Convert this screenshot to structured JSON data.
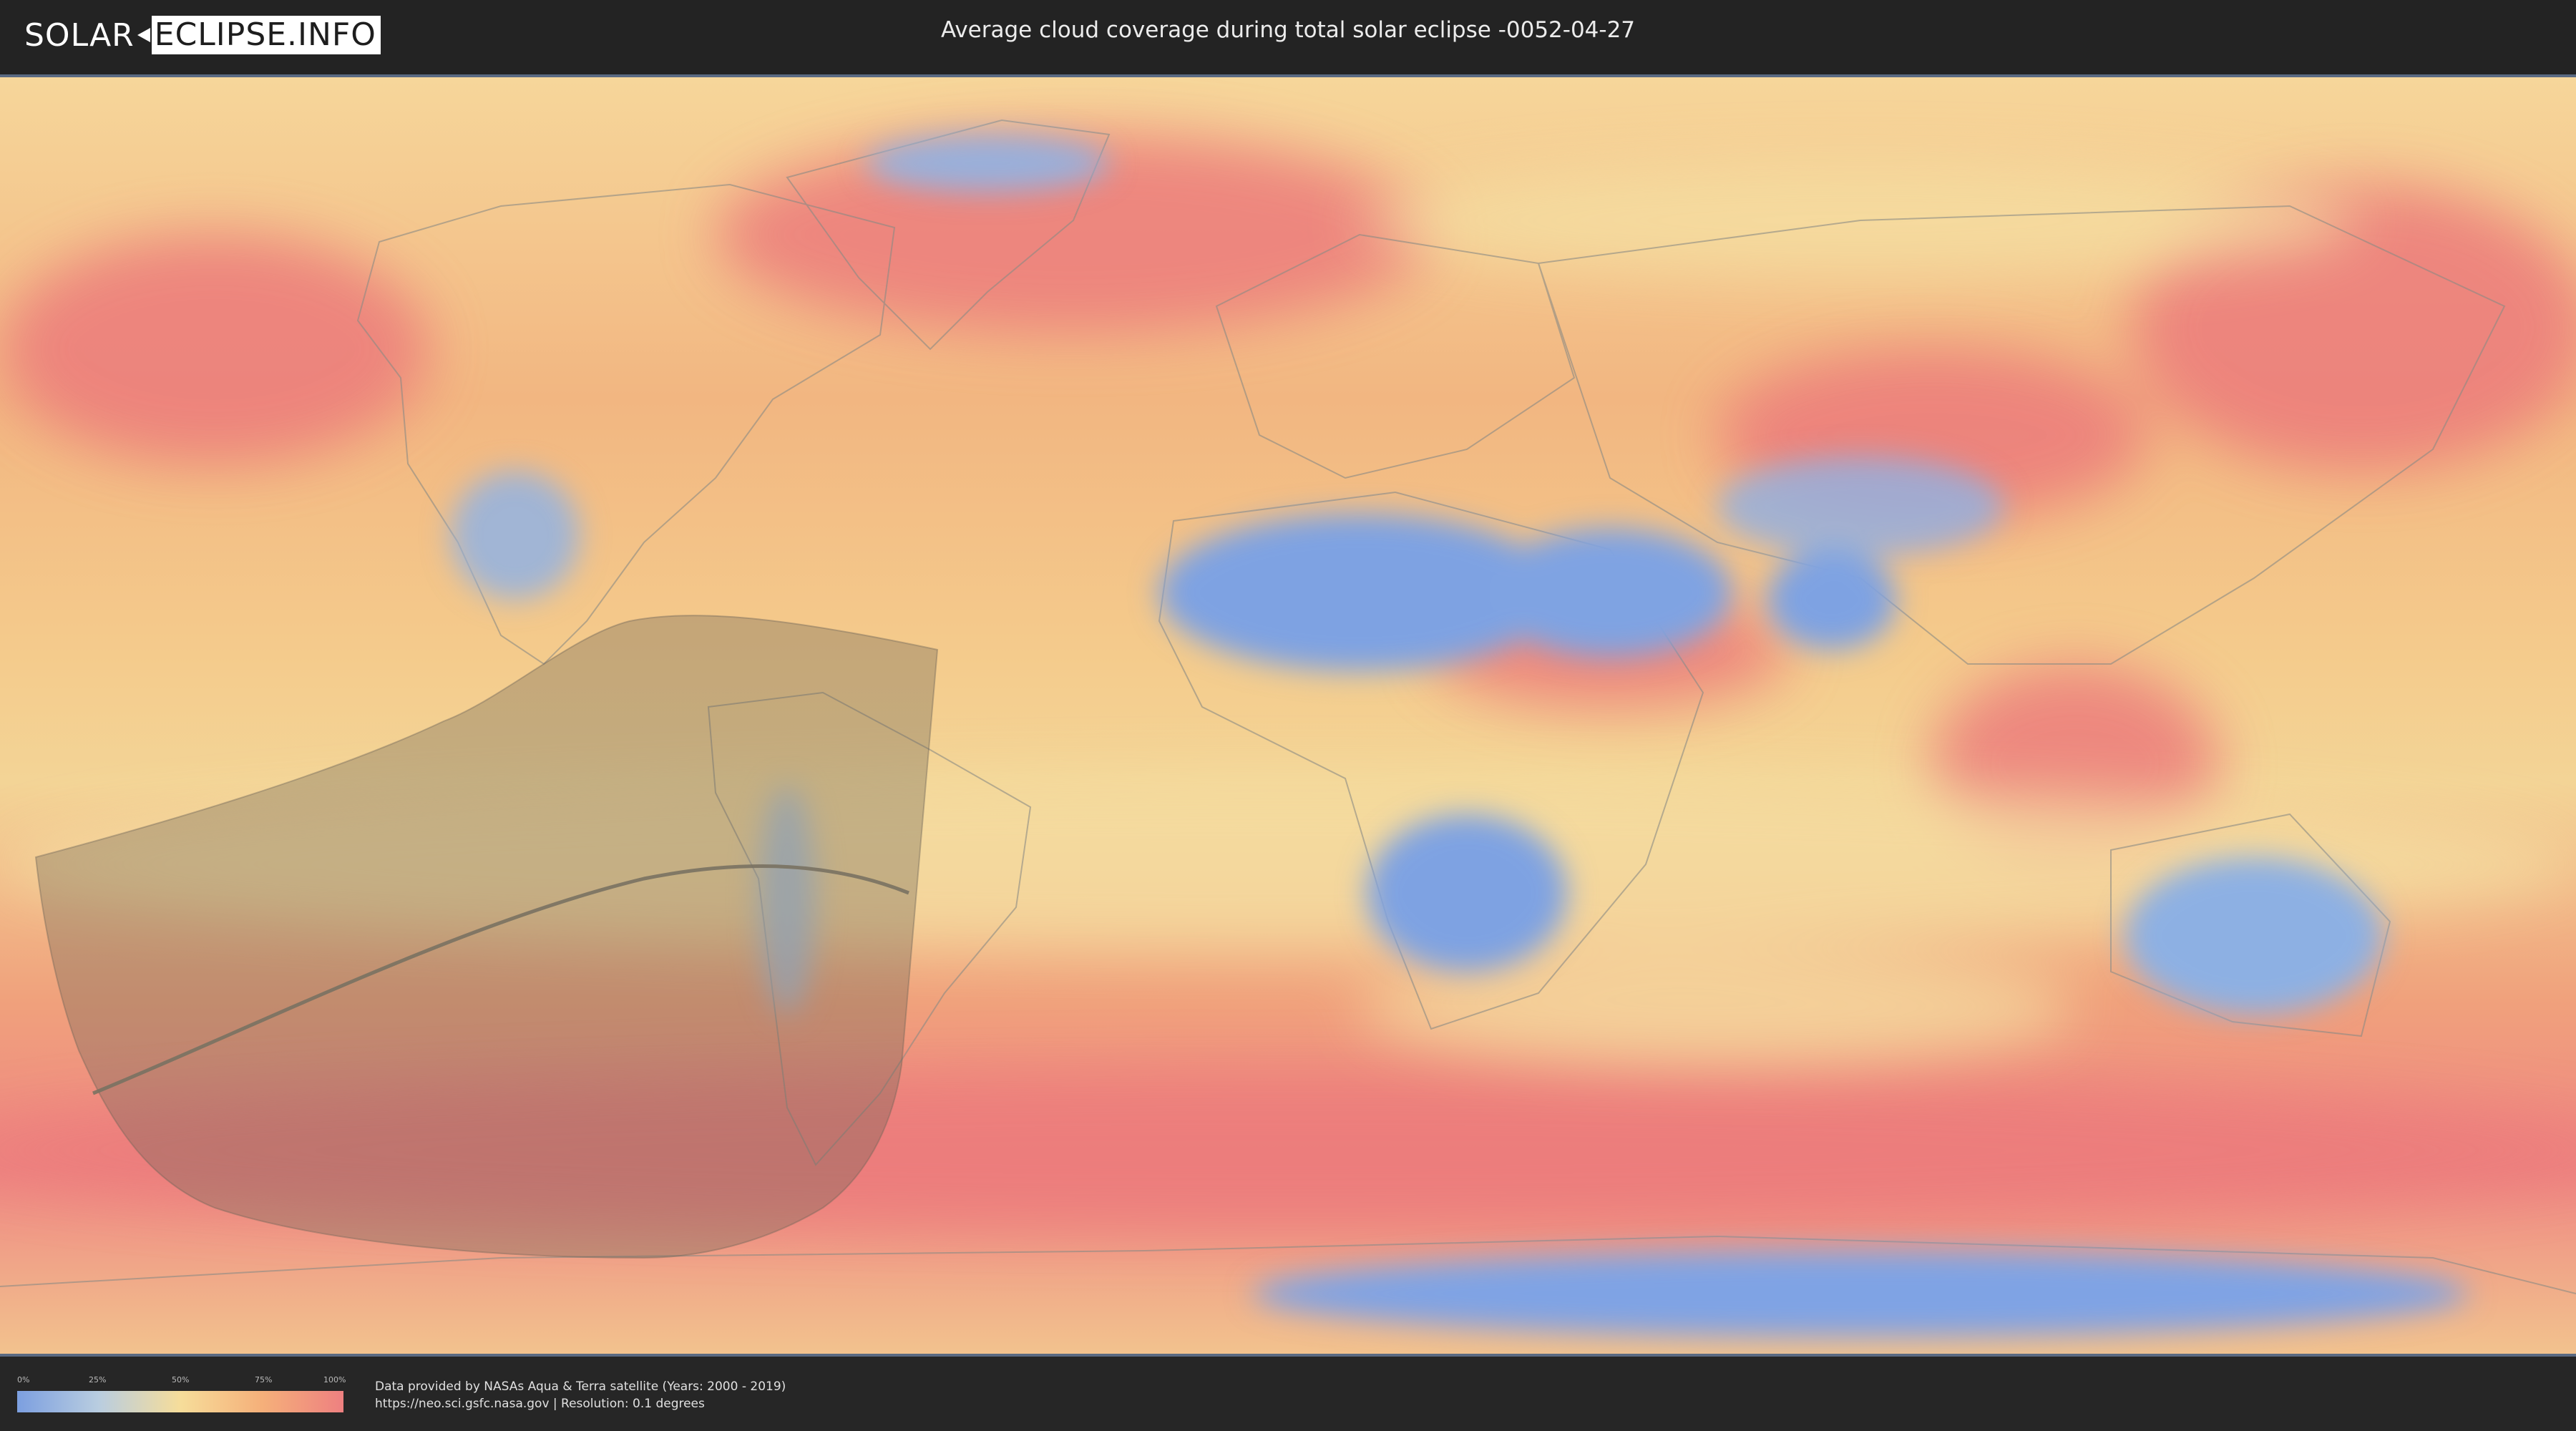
{
  "header": {
    "logo_left": "SOLAR",
    "logo_right": "ECLIPSE.INFO",
    "title": "Average cloud coverage during total solar eclipse -0052-04-27"
  },
  "map": {
    "description_layer": "cloud-coverage",
    "colors": {
      "clear": "#7b9fe3",
      "low": "#b6cde6",
      "mid": "#f3dd9c",
      "high": "#f4ae78",
      "full": "#ec7a7a",
      "eclipse_shadow": "#6b6353"
    }
  },
  "legend": {
    "ticks": [
      "0%",
      "25%",
      "50%",
      "75%",
      "100%"
    ]
  },
  "credit": {
    "line1": "Data provided by NASAs Aqua & Terra satellite (Years: 2000 - 2019)",
    "line2": "https://neo.sci.gsfc.nasa.gov | Resolution: 0.1 degrees"
  }
}
